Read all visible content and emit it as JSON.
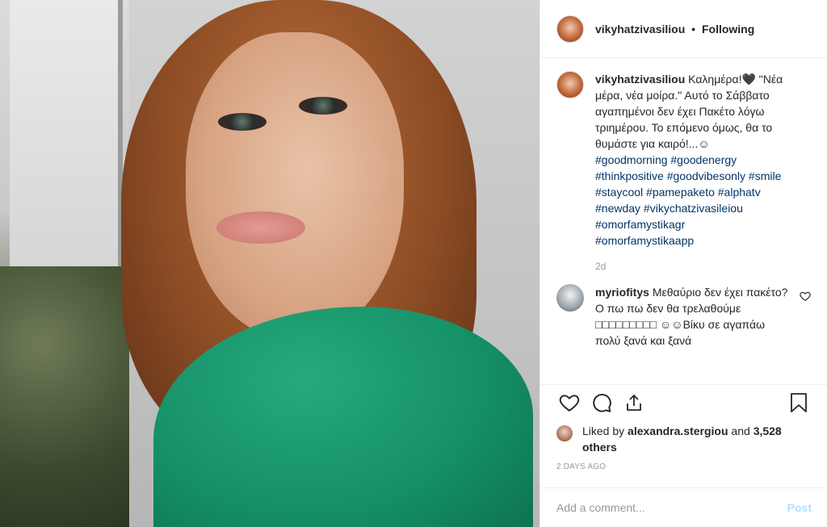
{
  "header": {
    "username": "vikyhatzivasiliou",
    "separator": "•",
    "follow_status": "Following"
  },
  "caption": {
    "username": "vikyhatzivasiliou",
    "text": "Καλημέρα!🖤 \"Νέα μέρα, νέα μοίρα.\" Αυτό το Σάββατο αγαπημένοι δεν έχει Πακέτο λόγω τριημέρου. Το επόμενο όμως, θα το θυμάστε για καιρό!...☺",
    "hashtags": [
      "#goodmorning #goodenergy",
      "#thinkpositive #goodvibesonly #smile",
      "#staycool #pamepaketo #alphatv",
      "#newday #vikychatzivasileiou",
      "#omorfamystikagr",
      "#omorfamystikaapp"
    ],
    "age": "2d"
  },
  "comment": {
    "username": "myriofitys",
    "text": "Μεθαύριο δεν έχει πακέτο? Ο πω πω δεν θα τρελαθούμε □□□□□□□□□ ☺☺Βίκυ σε αγαπάω πολύ ξανά και ξανά"
  },
  "icons": {
    "like": "heart-icon",
    "comment": "comment-icon",
    "share": "share-icon",
    "save": "bookmark-icon",
    "comment_like": "heart-small-icon"
  },
  "likes": {
    "prefix": "Liked by ",
    "user": "alexandra.stergiou",
    "joiner": " and ",
    "count": "3,528 others"
  },
  "posted": "2 DAYS AGO",
  "add_comment": {
    "placeholder": "Add a comment...",
    "post_label": "Post"
  }
}
